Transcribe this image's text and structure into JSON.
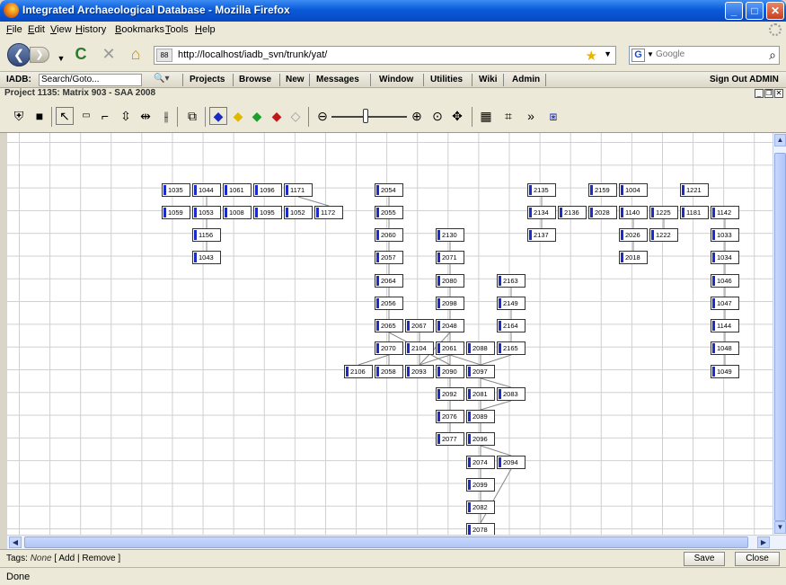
{
  "window": {
    "title": "Integrated Archaeological Database - Mozilla Firefox"
  },
  "menu": [
    "File",
    "Edit",
    "View",
    "History",
    "Bookmarks",
    "Tools",
    "Help"
  ],
  "nav": {
    "url": "http://localhost/iadb_svn/trunk/yat/",
    "search_placeholder": "Google",
    "site_id": "88"
  },
  "app_nav": {
    "label": "IADB:",
    "search_value": "Search/Goto...",
    "items": [
      "Projects",
      "Browse",
      "New",
      "Messages",
      "Window",
      "Utilities",
      "Wiki",
      "Admin"
    ],
    "sign_out": "Sign Out ADMIN"
  },
  "project_title": "Project 1135: Matrix 903 - SAA 2008",
  "icons": {
    "toolbar": [
      "tree-icon",
      "save-icon",
      "select-link-icon",
      "box-icon",
      "connector-icon",
      "vertical-distribute-icon",
      "horizontal-align-icon",
      "vertical-align-icon",
      "group-icon",
      "diamond-blue-icon",
      "diamond-yellow-icon",
      "diamond-green-icon",
      "diamond-red-icon",
      "diamond-white-icon",
      "zoom-out-icon",
      "zoom-in-icon",
      "zoom-fit-icon",
      "pan-icon",
      "grid-icon",
      "layout-icon",
      "forward-icon",
      "export-icon"
    ]
  },
  "matrix": {
    "nodes": [
      {
        "id": "1035"
      },
      {
        "id": "1044"
      },
      {
        "id": "1061"
      },
      {
        "id": "1096"
      },
      {
        "id": "1171"
      },
      {
        "id": "1059"
      },
      {
        "id": "1053"
      },
      {
        "id": "1008"
      },
      {
        "id": "1095"
      },
      {
        "id": "1052"
      },
      {
        "id": "1172"
      },
      {
        "id": "1156"
      },
      {
        "id": "1043"
      },
      {
        "id": "2054"
      },
      {
        "id": "2055"
      },
      {
        "id": "2060"
      },
      {
        "id": "2057"
      },
      {
        "id": "2064"
      },
      {
        "id": "2056"
      },
      {
        "id": "2065"
      },
      {
        "id": "2067"
      },
      {
        "id": "2070"
      },
      {
        "id": "2104"
      },
      {
        "id": "2106"
      },
      {
        "id": "2058"
      },
      {
        "id": "2093"
      },
      {
        "id": "2130"
      },
      {
        "id": "2071"
      },
      {
        "id": "2080"
      },
      {
        "id": "2098"
      },
      {
        "id": "2048"
      },
      {
        "id": "2061"
      },
      {
        "id": "2090"
      },
      {
        "id": "2092"
      },
      {
        "id": "2076"
      },
      {
        "id": "2077"
      },
      {
        "id": "2088"
      },
      {
        "id": "2097"
      },
      {
        "id": "2081"
      },
      {
        "id": "2089"
      },
      {
        "id": "2096"
      },
      {
        "id": "2074"
      },
      {
        "id": "2099"
      },
      {
        "id": "2082"
      },
      {
        "id": "2078"
      },
      {
        "id": "2094"
      },
      {
        "id": "2163"
      },
      {
        "id": "2149"
      },
      {
        "id": "2164"
      },
      {
        "id": "2165"
      },
      {
        "id": "2083"
      },
      {
        "id": "2135"
      },
      {
        "id": "2134"
      },
      {
        "id": "2136"
      },
      {
        "id": "2137"
      },
      {
        "id": "2159"
      },
      {
        "id": "1004"
      },
      {
        "id": "2028"
      },
      {
        "id": "1140"
      },
      {
        "id": "1225"
      },
      {
        "id": "2026"
      },
      {
        "id": "1222"
      },
      {
        "id": "2018"
      },
      {
        "id": "1221"
      },
      {
        "id": "1181"
      },
      {
        "id": "1142"
      },
      {
        "id": "1033"
      },
      {
        "id": "1034"
      },
      {
        "id": "1046"
      },
      {
        "id": "1047"
      },
      {
        "id": "1144"
      },
      {
        "id": "1048"
      },
      {
        "id": "1049"
      }
    ]
  },
  "tags": {
    "label": "Tags:",
    "value": "None",
    "add": "Add",
    "remove": "Remove"
  },
  "buttons": {
    "save": "Save",
    "close": "Close"
  },
  "status": "Done"
}
